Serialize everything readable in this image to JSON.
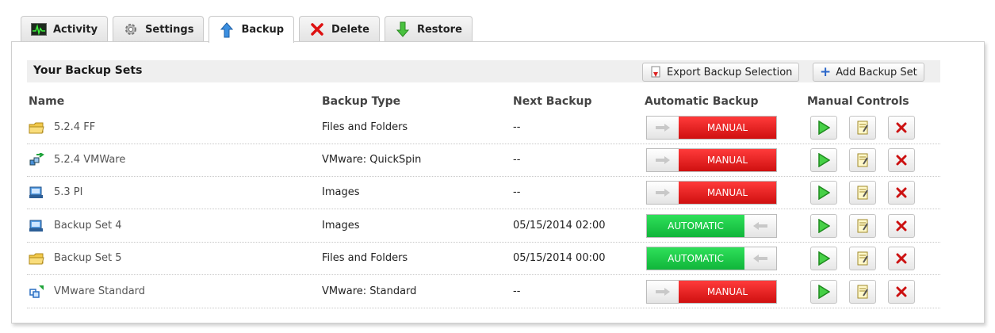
{
  "tabs": [
    {
      "label": "Activity",
      "icon": "activity-monitor-icon"
    },
    {
      "label": "Settings",
      "icon": "gear-icon"
    },
    {
      "label": "Backup",
      "icon": "up-arrow-icon"
    },
    {
      "label": "Delete",
      "icon": "red-x-icon"
    },
    {
      "label": "Restore",
      "icon": "down-arrow-icon"
    }
  ],
  "active_tab": "Backup",
  "panel": {
    "title": "Your Backup Sets",
    "export_label": "Export Backup Selection",
    "add_label": "Add Backup Set"
  },
  "columns": {
    "name": "Name",
    "type": "Backup Type",
    "next": "Next Backup",
    "auto": "Automatic Backup",
    "manual": "Manual Controls"
  },
  "rows": [
    {
      "name": "5.2.4 FF",
      "type": "Files and Folders",
      "next": "--",
      "mode": "MANUAL",
      "icon": "folder-icon"
    },
    {
      "name": "5.2.4 VMWare",
      "type": "VMware: QuickSpin",
      "next": "--",
      "mode": "MANUAL",
      "icon": "vmware-quickspin-icon"
    },
    {
      "name": "5.3 PI",
      "type": "Images",
      "next": "--",
      "mode": "MANUAL",
      "icon": "disk-image-icon"
    },
    {
      "name": "Backup Set 4",
      "type": "Images",
      "next": "05/15/2014 02:00",
      "mode": "AUTOMATIC",
      "icon": "disk-image-icon"
    },
    {
      "name": "Backup Set 5",
      "type": "Files and Folders",
      "next": "05/15/2014 00:00",
      "mode": "AUTOMATIC",
      "icon": "folder-icon"
    },
    {
      "name": "VMware Standard",
      "type": "VMware: Standard",
      "next": "--",
      "mode": "MANUAL",
      "icon": "vmware-standard-icon"
    }
  ],
  "colors": {
    "manual": "#e01919",
    "automatic": "#1fc94a",
    "play": "#2fb82f",
    "delete": "#cc1111"
  }
}
